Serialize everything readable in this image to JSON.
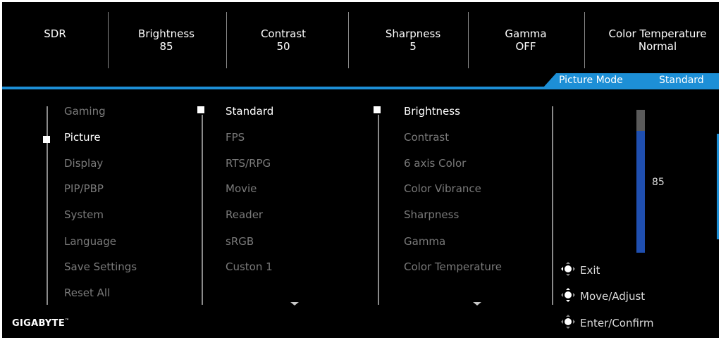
{
  "status_bar": [
    {
      "label": "SDR",
      "value": ""
    },
    {
      "label": "Brightness",
      "value": "85"
    },
    {
      "label": "Contrast",
      "value": "50"
    },
    {
      "label": "Sharpness",
      "value": "5"
    },
    {
      "label": "Gamma",
      "value": "OFF"
    },
    {
      "label": "Color Temperature",
      "value": "Normal"
    }
  ],
  "picture_mode": {
    "label": "Picture Mode",
    "value": "Standard"
  },
  "main_menu": {
    "items": [
      "Gaming",
      "Picture",
      "Display",
      "PIP/PBP",
      "System",
      "Language",
      "Save Settings",
      "Reset All"
    ],
    "selected": "Picture"
  },
  "mode_menu": {
    "items": [
      "Standard",
      "FPS",
      "RTS/RPG",
      "Movie",
      "Reader",
      "sRGB",
      "Custon 1"
    ],
    "selected": "Standard"
  },
  "setting_menu": {
    "items": [
      "Brightness",
      "Contrast",
      "6 axis Color",
      "Color Vibrance",
      "Sharpness",
      "Gamma",
      "Color Temperature"
    ],
    "selected": "Brightness"
  },
  "level": {
    "value": "85",
    "fraction": 0.85
  },
  "help": {
    "exit": "Exit",
    "move": "Move/Adjust",
    "enter": "Enter/Confirm"
  },
  "brand": "GIGABYTE",
  "colors": {
    "accent": "#1d8fd6",
    "bar_fill": "#1f4fb0",
    "inactive_text": "#7a7a7a"
  }
}
